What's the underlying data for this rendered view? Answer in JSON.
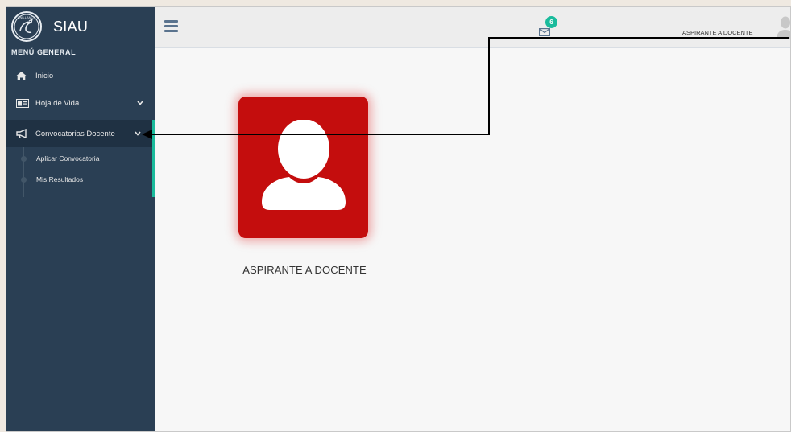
{
  "brand": {
    "title": "SIAU",
    "logo_text": "UNILLANOS"
  },
  "sidebar": {
    "section_title": "MENÚ GENERAL",
    "items": [
      {
        "label": "Inicio",
        "icon": "home-icon"
      },
      {
        "label": "Hoja de Vida",
        "icon": "id-card-icon"
      },
      {
        "label": "Convocatorias Docente",
        "icon": "bullhorn-icon"
      }
    ],
    "subitems": [
      {
        "label": "Aplicar Convocatoria"
      },
      {
        "label": "Mis Resultados"
      }
    ]
  },
  "topbar": {
    "notification_count": "6",
    "user_name": "ASPIRANTE A DOCENTE"
  },
  "main": {
    "profile_label": "ASPIRANTE A DOCENTE"
  },
  "colors": {
    "sidebar_bg": "#2a3f54",
    "accent": "#1abb9c",
    "card_red": "#c40d0d"
  }
}
